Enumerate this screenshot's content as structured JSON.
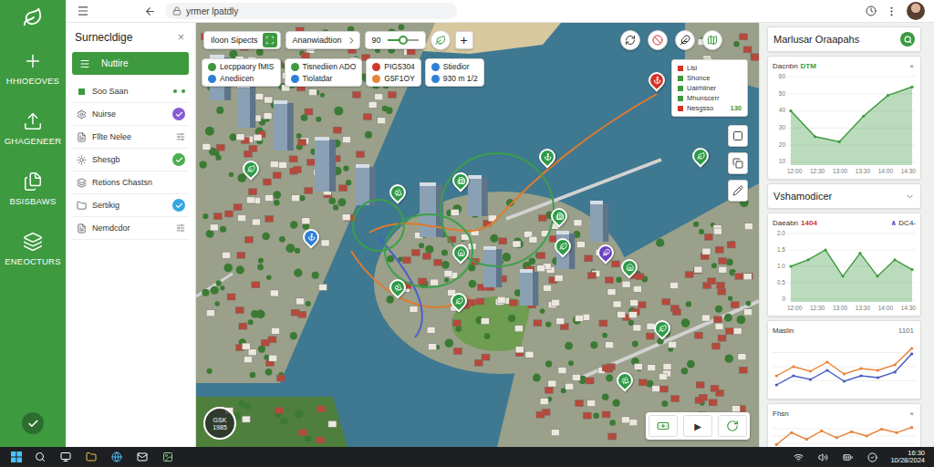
{
  "browser": {
    "url": "yrmer lpatdly"
  },
  "sidebar": {
    "items": [
      {
        "label": "HHIOEOVES"
      },
      {
        "label": "GHAGENEER"
      },
      {
        "label": "BSISBAWS"
      },
      {
        "label": "ENEOCTURS"
      }
    ]
  },
  "panel": {
    "title": "Surnecldige",
    "close": "×",
    "button": "Nuttire",
    "items": [
      {
        "label": "Soo Saan",
        "kind": "dots",
        "color": "#3d9a3f"
      },
      {
        "label": "Nuirse",
        "kind": "circle",
        "color": "#8a5bd6"
      },
      {
        "label": "Fllte Nelee",
        "kind": "icons",
        "color": "#777777"
      },
      {
        "label": "Shesgb",
        "kind": "circle",
        "color": "#4caf50"
      },
      {
        "label": "Retions Chastsn",
        "kind": "none"
      },
      {
        "label": "Sertikig",
        "kind": "circle",
        "color": "#35a7e0"
      },
      {
        "label": "Nemdcdor",
        "kind": "icons",
        "color": "#777777"
      }
    ]
  },
  "map": {
    "toolbar": {
      "search": "Iloon Sipects",
      "layer": "Ananwiadtion",
      "zoom": {
        "value": "90",
        "level": 0.5
      },
      "add": "+"
    },
    "chips": [
      {
        "lines": [
          {
            "text": "Lecppaory fMIS",
            "color": "#3d9a3f"
          },
          {
            "text": "Anediicen",
            "color": "#2f7fd6"
          }
        ]
      },
      {
        "lines": [
          {
            "text": "Tisnediien ADO",
            "color": "#3d9a3f"
          },
          {
            "text": "Tiolatdar",
            "color": "#2f7fd6"
          }
        ]
      },
      {
        "lines": [
          {
            "text": "PIG5304",
            "color": "#d4352b"
          },
          {
            "text": "G5F1OY",
            "color": "#e8843a"
          }
        ]
      },
      {
        "lines": [
          {
            "text": "Stiedior",
            "color": "#2f7fd6"
          },
          {
            "text": "930 m 1/2",
            "color": "#2f7fd6"
          }
        ]
      }
    ],
    "legend": {
      "items": [
        {
          "label": "Llsi",
          "color": "#d4352b"
        },
        {
          "label": "Shonce",
          "color": "#3d9a3f"
        },
        {
          "label": "Uairhiiner",
          "color": "#3d9a3f"
        },
        {
          "label": "Mhunscerr",
          "color": "#3d9a3f"
        },
        {
          "label": "Nesgsso",
          "color": "#d4352b"
        }
      ],
      "value": "130"
    },
    "pins": [
      {
        "color": "#2e9b47"
      },
      {
        "color": "#2e9b47"
      },
      {
        "color": "#2e9b47"
      },
      {
        "color": "#2e9b47"
      },
      {
        "color": "#2e9b47"
      },
      {
        "color": "#2f7fd6"
      },
      {
        "color": "#2e9b47"
      },
      {
        "color": "#2e9b47"
      },
      {
        "color": "#2e9b47"
      },
      {
        "color": "#2e9b47"
      },
      {
        "color": "#2e9b47"
      },
      {
        "color": "#6b3fc2"
      },
      {
        "color": "#2e9b47"
      },
      {
        "color": "#2e9b47"
      },
      {
        "color": "#2e9b47"
      },
      {
        "color": "#d4352b"
      }
    ],
    "badge": {
      "top": "GSK",
      "bottom": "1985"
    },
    "controls": {
      "play": "▶"
    }
  },
  "rightPanel": {
    "title": "Marlusar Oraapahs",
    "section": "Vshamodicer",
    "charts": [
      {
        "title": "Dacnbn",
        "tag": "DTM",
        "tagColor": "#3d9a3f",
        "action": "×",
        "ticks": [
          "60",
          "50",
          "40",
          "30",
          "20",
          "10"
        ],
        "xTicks": [
          "12:00",
          "12:30",
          "13:00",
          "13:30",
          "14:00",
          "14:30"
        ],
        "series": [
          {
            "color": "#3d9a3f",
            "area": true,
            "values": [
              40,
              25,
              22,
              37,
              49,
              54
            ]
          }
        ]
      },
      {
        "title": "Daeabn",
        "tag": "1404",
        "tagColor": "#d4352b",
        "legend": {
          "mark": "∧",
          "color": "#5b4fcf",
          "text": "DC4-"
        },
        "ticks": [
          "2.0",
          "1.5",
          "1.0",
          "0.5",
          "0"
        ],
        "xTicks": [
          "12:00",
          "12:30",
          "13:00",
          "13:30",
          "14:00",
          "14:30"
        ],
        "series": [
          {
            "color": "#3d9a3f",
            "area": true,
            "values": [
              1.0,
              1.2,
              1.5,
              0.7,
              1.4,
              0.7,
              1.2,
              0.9
            ]
          }
        ]
      },
      {
        "title": "Maslin",
        "action": "1101",
        "ticks": [],
        "xTicks": [],
        "series": [
          {
            "color": "#e8843a",
            "area": false,
            "values": [
              40,
              50,
              45,
              55,
              42,
              48,
              46,
              52,
              70
            ]
          },
          {
            "color": "#4a5fc1",
            "area": false,
            "values": [
              30,
              40,
              36,
              46,
              34,
              40,
              38,
              44,
              64
            ]
          }
        ]
      },
      {
        "title": "Fhsn",
        "action": "×",
        "ticks": [],
        "xTicks": [],
        "series": [
          {
            "color": "#e8843a",
            "area": false,
            "values": [
              30,
              44,
              36,
              46,
              38,
              45,
              40,
              48,
              44,
              50
            ]
          }
        ]
      }
    ]
  },
  "taskbar": {
    "time": "16:30",
    "date": "10/28/2024"
  }
}
